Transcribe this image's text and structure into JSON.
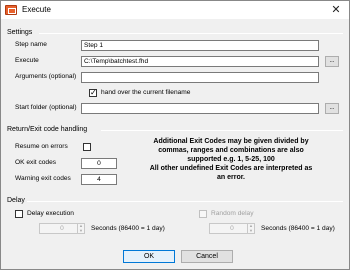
{
  "window": {
    "title": "Execute",
    "close_glyph": "✕"
  },
  "settings": {
    "section_label": "Settings",
    "step_name_label": "Step name",
    "step_name_value": "Step 1",
    "execute_label": "Execute",
    "execute_value": "C:\\Temp\\batchtest.fhd",
    "browse_label": "...",
    "arguments_label": "Arguments (optional)",
    "arguments_value": "",
    "hand_over_label": "hand over the current filename",
    "hand_over_checked": true,
    "start_folder_label": "Start folder (optional)",
    "start_folder_value": ""
  },
  "return_codes": {
    "section_label": "Return/Exit code handling",
    "resume_label": "Resume on errors",
    "resume_checked": false,
    "ok_codes_label": "OK exit codes",
    "ok_codes_value": "0",
    "warning_codes_label": "Warning exit codes",
    "warning_codes_value": "4",
    "info_lines": [
      "Additional Exit Codes may be given divided by",
      "commas, ranges and combinations are also",
      "supported e.g. 1, 5-25, 100",
      "All other undefined Exit Codes are interpreted as",
      "an error."
    ]
  },
  "delay": {
    "section_label": "Delay",
    "delay_execution_label": "Delay execution",
    "delay_execution_checked": false,
    "random_delay_label": "Random delay",
    "random_delay_checked": false,
    "seconds_value_1": "0",
    "seconds_label_1": "Seconds (86400 = 1 day)",
    "seconds_value_2": "0",
    "seconds_label_2": "Seconds (86400 = 1 day)"
  },
  "footer": {
    "ok_label": "OK",
    "cancel_label": "Cancel"
  },
  "icons": {
    "app": "execute-app-icon",
    "close": "close-icon",
    "check": "checkmark-icon",
    "spin": "spin-arrows-icon"
  },
  "colors": {
    "ok_button_border": "#0078d7",
    "window_bg": "#f0f0f0",
    "app_icon": "#e8612c"
  }
}
